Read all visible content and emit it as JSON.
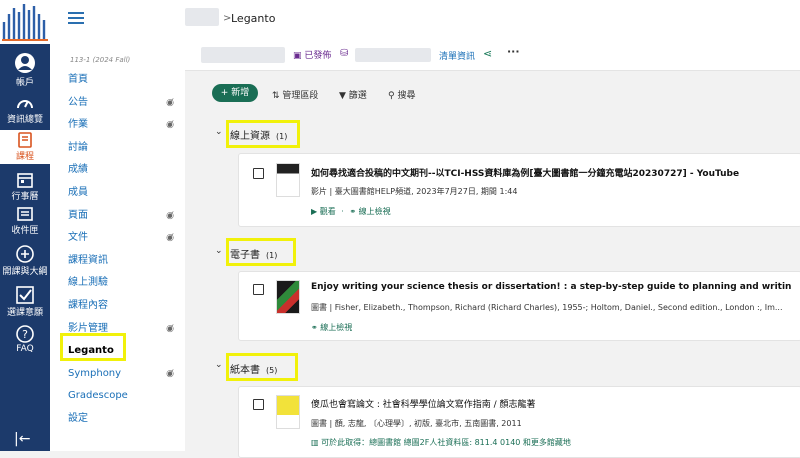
{
  "global_nav": {
    "items": [
      {
        "label": "帳戶",
        "icon": "account-icon"
      },
      {
        "label": "資訊總覽",
        "icon": "dashboard-icon"
      },
      {
        "label": "課程",
        "icon": "course-book-icon"
      },
      {
        "label": "行事曆",
        "icon": "calendar-icon"
      },
      {
        "label": "收件匣",
        "icon": "inbox-icon"
      },
      {
        "label": "開課與大綱",
        "icon": "plus-circle-icon"
      },
      {
        "label": "選課意願",
        "icon": "checkbox-icon"
      },
      {
        "label": "FAQ",
        "icon": "help-icon"
      }
    ],
    "collapse_glyph": "|←"
  },
  "course_nav": {
    "term": "113-1 (2024 Fall)",
    "items": [
      {
        "label": "首頁",
        "hidden": false
      },
      {
        "label": "公告",
        "hidden": true
      },
      {
        "label": "作業",
        "hidden": true
      },
      {
        "label": "討論",
        "hidden": false
      },
      {
        "label": "成績",
        "hidden": false
      },
      {
        "label": "成員",
        "hidden": false
      },
      {
        "label": "頁面",
        "hidden": true
      },
      {
        "label": "文件",
        "hidden": true
      },
      {
        "label": "課程資訊",
        "hidden": false
      },
      {
        "label": "線上測驗",
        "hidden": false
      },
      {
        "label": "課程內容",
        "hidden": false
      },
      {
        "label": "影片管理",
        "hidden": true
      },
      {
        "label": "Leganto",
        "hidden": false
      },
      {
        "label": "Symphony",
        "hidden": true
      },
      {
        "label": "Gradescope",
        "hidden": false
      },
      {
        "label": "設定",
        "hidden": false
      }
    ]
  },
  "breadcrumb": {
    "separator": ">",
    "current": "Leganto"
  },
  "list_bar": {
    "status": "已發佈",
    "list_info": "清單資訊",
    "share_icon": "share-icon",
    "more": "···"
  },
  "actions": {
    "add": "+ 新增",
    "manage_sections": "管理區段",
    "filter": "篩選",
    "search": "搜尋"
  },
  "sections": [
    {
      "name": "線上資源",
      "count": "(1)",
      "item": {
        "title": "如何尋找適合投稿的中文期刊--以TCI-HSS資料庫為例[臺大圖書館一分鐘充電站20230727] - YouTube",
        "meta": "影片 | 臺大圖書館HELP頻道, 2023年7月27日, 期間 1:44",
        "links": [
          "觀看",
          "線上檢視"
        ]
      }
    },
    {
      "name": "電子書",
      "count": "(1)",
      "item": {
        "title": "Enjoy writing your science thesis or dissertation! : a step-by-step guide to planning and writing a thesis or d...",
        "meta": "圖書 | Fisher, Elizabeth., Thompson, Richard (Richard Charles), 1955-; Holtom, Daniel., Second edition., London :, Im...",
        "links": [
          "線上檢視"
        ]
      }
    },
    {
      "name": "紙本書",
      "count": "(5)",
      "item": {
        "title": "傻瓜也會寫論文 : 社會科學學位論文寫作指南 / 顏志龍著",
        "meta": "圖書 | 顏, 志龍, 〔心理學〕, 初版, 臺北市, 五南圖書, 2011",
        "links": [
          "可於此取得：總圖書館 總圖2F人社資料區: 811.4 0140 和更多館藏地"
        ]
      }
    }
  ]
}
